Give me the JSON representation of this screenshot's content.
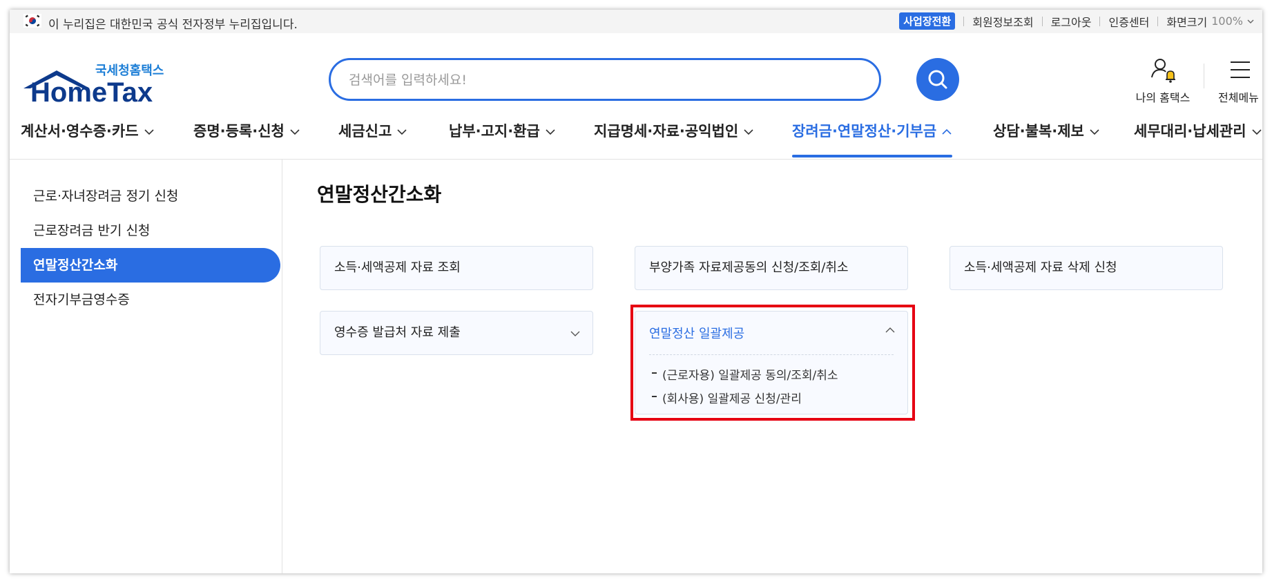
{
  "gov_banner": {
    "text": "이 누리집은 대한민국 공식 전자정부 누리집입니다."
  },
  "utility": {
    "biz_switch": "사업장전환",
    "member_info": "회원정보조회",
    "logout": "로그아웃",
    "cert_center": "인증센터",
    "zoom_label": "화면크기",
    "zoom_value": "100%"
  },
  "logo": {
    "kr": "국세청홈택스",
    "en": "HomeTax"
  },
  "search": {
    "placeholder": "검색어를 입력하세요!"
  },
  "header_links": {
    "my_hometax": "나의 홈택스",
    "all_menu": "전체메뉴"
  },
  "gnb": {
    "items": [
      {
        "label": "계산서·영수증·카드"
      },
      {
        "label": "증명·등록·신청"
      },
      {
        "label": "세금신고"
      },
      {
        "label": "납부·고지·환급"
      },
      {
        "label": "지급명세·자료·공익법인"
      },
      {
        "label": "장려금·연말정산·기부금",
        "active": true
      },
      {
        "label": "상담·불복·제보"
      },
      {
        "label": "세무대리·납세관리"
      }
    ]
  },
  "lnb": {
    "items": [
      {
        "label": "근로·자녀장려금 정기 신청"
      },
      {
        "label": "근로장려금 반기 신청"
      },
      {
        "label": "연말정산간소화",
        "active": true
      },
      {
        "label": "전자기부금영수증"
      }
    ]
  },
  "main": {
    "title": "연말정산간소화",
    "cards": [
      {
        "label": "소득·세액공제 자료 조회"
      },
      {
        "label": "부양가족 자료제공동의 신청/조회/취소"
      },
      {
        "label": "소득·세액공제 자료 삭제 신청"
      },
      {
        "label": "영수증 발급처 자료 제출"
      }
    ],
    "expanded_card": {
      "label": "연말정산 일괄제공",
      "sub_items": [
        {
          "label": "(근로자용) 일괄제공 동의/조회/취소"
        },
        {
          "label": "(회사용) 일괄제공 신청/관리"
        }
      ]
    }
  },
  "colors": {
    "accent": "#2a6de2",
    "logo_navy": "#0d3a8c",
    "highlight_red": "#e60012"
  }
}
